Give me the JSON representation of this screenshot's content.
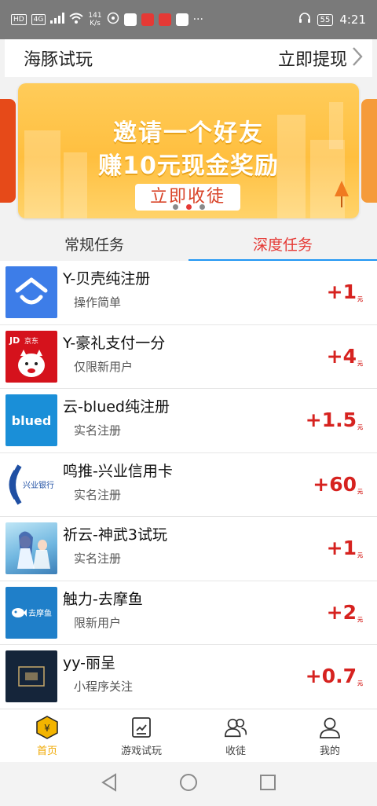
{
  "status_bar": {
    "network_chips": [
      "HD",
      "4G"
    ],
    "speed_value": "141",
    "speed_unit": "K/s",
    "more": "···",
    "battery": "55",
    "time": "4:21"
  },
  "header": {
    "title": "海豚试玩",
    "withdraw_label": "立即提现"
  },
  "banner": {
    "line1": "邀请一个好友",
    "line2": "赚10元现金奖励",
    "button_label": "立即收徒",
    "slide_count": 3,
    "active_slide": 1
  },
  "tabs": [
    {
      "label": "常规任务",
      "active": false
    },
    {
      "label": "深度任务",
      "active": true
    }
  ],
  "tasks": [
    {
      "title": "Y-贝壳纯注册",
      "subtitle": "操作简单",
      "reward": "+1",
      "unit": "元",
      "icon": "beike-logo-icon",
      "color": "#3d7de8"
    },
    {
      "title": "Y-豪礼支付一分",
      "subtitle": "仅限新用户",
      "reward": "+4",
      "unit": "元",
      "icon": "jd-logo-icon",
      "color": "#d5121c"
    },
    {
      "title": "云-blued纯注册",
      "subtitle": "实名注册",
      "reward": "+1.5",
      "unit": "元",
      "icon": "blued-logo-icon",
      "color": "#1a8fd8"
    },
    {
      "title": "鸣推-兴业信用卡",
      "subtitle": "实名注册",
      "reward": "+60",
      "unit": "元",
      "icon": "industrial-bank-logo-icon",
      "color": "#ffffff"
    },
    {
      "title": "祈云-神武3试玩",
      "subtitle": "实名注册",
      "reward": "+1",
      "unit": "元",
      "icon": "shenwu-game-icon",
      "color": "#7fc8e8"
    },
    {
      "title": "触力-去摩鱼",
      "subtitle": "限新用户",
      "reward": "+2",
      "unit": "元",
      "icon": "qumoyu-logo-icon",
      "color": "#1f7fc9"
    },
    {
      "title": "yy-丽呈",
      "subtitle": "小程序关注",
      "reward": "+0.7",
      "unit": "元",
      "icon": "licheng-logo-icon",
      "color": "#15253a"
    }
  ],
  "thumb_text": {
    "jd": "JD",
    "jd_sub": "京东",
    "blued": "blued",
    "bank": "兴业银行",
    "qumoyu": "去摩鱼"
  },
  "bottom_nav": [
    {
      "label": "首页",
      "icon": "home-hexagon-icon",
      "active": true
    },
    {
      "label": "游戏试玩",
      "icon": "game-doc-icon",
      "active": false
    },
    {
      "label": "收徒",
      "icon": "apprentice-users-icon",
      "active": false
    },
    {
      "label": "我的",
      "icon": "profile-icon",
      "active": false
    }
  ],
  "colors": {
    "accent": "#e53935",
    "reward": "#d6221f",
    "nav_active": "#f0a800",
    "tab_underline": "#2196f3"
  }
}
